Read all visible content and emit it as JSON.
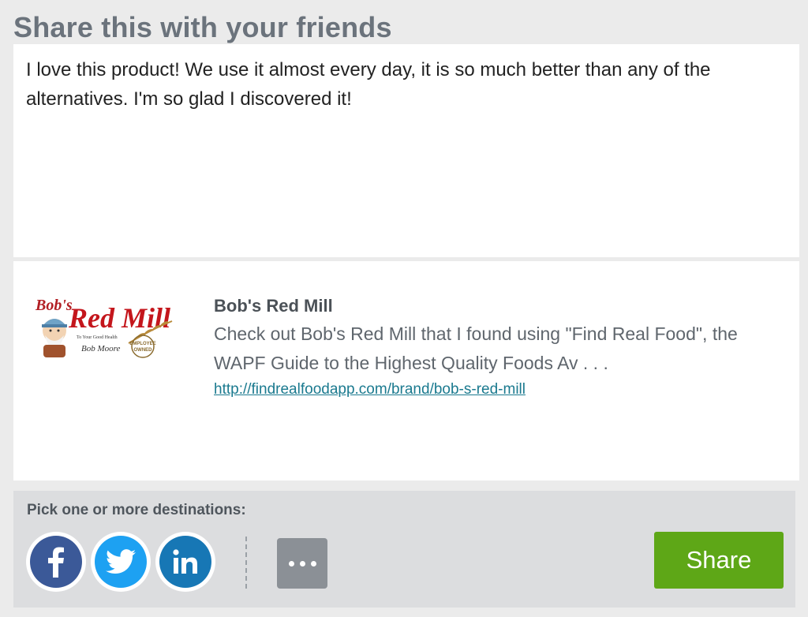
{
  "header": {
    "title": "Share this with your friends"
  },
  "message": {
    "text": "I love this product! We use it almost every day, it is so much better than any of the alternatives. I'm so glad I discovered it!"
  },
  "preview": {
    "title": "Bob's Red Mill",
    "description": "Check out Bob's Red Mill that I found using \"Find Real Food\", the WAPF Guide to the Highest Quality Foods Av . . .",
    "link": "http://findrealfoodapp.com/brand/bob-s-red-mill",
    "logo": {
      "name": "bobs-red-mill-logo",
      "text_top": "Bob's",
      "text_main": "Red Mill",
      "tagline": "To Your Good Health",
      "signature": "Bob Moore",
      "seal": "EMPLOYEE OWNED"
    }
  },
  "destinations": {
    "label": "Pick one or more destinations:",
    "items": [
      {
        "name": "facebook",
        "icon": "facebook-icon",
        "color": "#3b5998"
      },
      {
        "name": "twitter",
        "icon": "twitter-icon",
        "color": "#1da1f2"
      },
      {
        "name": "linkedin",
        "icon": "linkedin-icon",
        "color": "#1777b5"
      }
    ],
    "more_icon": "more-dots-icon",
    "share_label": "Share",
    "share_color": "#5ea717"
  }
}
